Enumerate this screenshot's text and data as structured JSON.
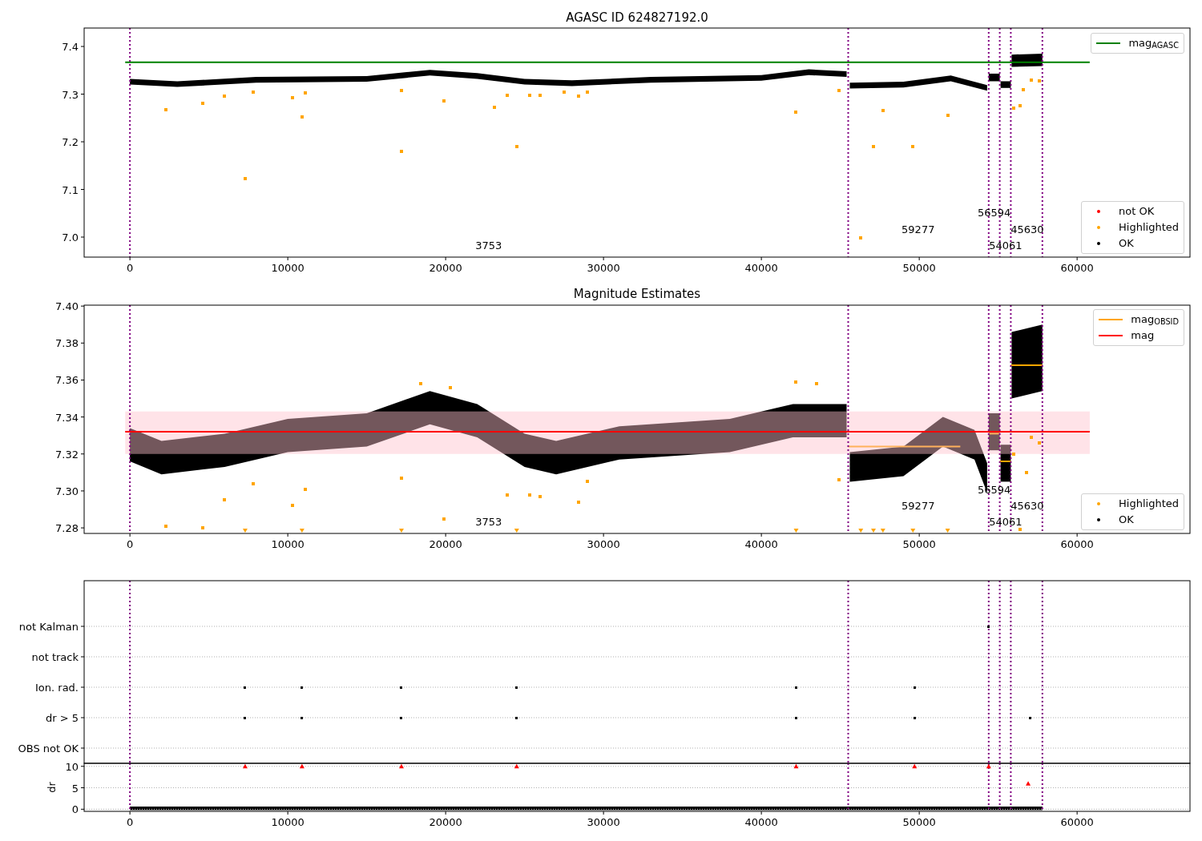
{
  "panels": [
    {
      "legends": [
        {
          "entries": [
            {
              "label": "mag$_{AGASC}$",
              "color": "#008000",
              "kind": "line"
            }
          ]
        },
        {
          "entries": [
            {
              "label": "not OK",
              "color": "#ff0000",
              "kind": "dot"
            },
            {
              "kind": "series"
            },
            {
              "label": "OK",
              "color": "#000000",
              "kind": "dot"
            }
          ]
        }
      ],
      "chart_data": {
        "type": "scatter",
        "title": "AGASC ID 624827192.0",
        "xlim": [
          -2900,
          67150
        ],
        "ylim": [
          6.958,
          7.4387
        ],
        "xticks": [
          0,
          10000,
          20000,
          30000,
          40000,
          50000,
          60000
        ],
        "yticks": [
          {
            "value": 7.0,
            "label": "7.0"
          },
          {
            "value": 7.1,
            "label": "7.1"
          },
          {
            "value": 7.2,
            "label": "7.2"
          },
          {
            "value": 7.3,
            "label": "7.3"
          },
          {
            "value": 7.4,
            "label": "7.4"
          }
        ],
        "x": [
          2300,
          4600,
          6000,
          7300,
          7800,
          10300,
          10900,
          11100,
          17200,
          17200,
          19900,
          23100,
          23900,
          24500,
          25300,
          26000,
          27500,
          28400,
          29000,
          42200,
          44900,
          46300,
          47100,
          47700,
          49600,
          51800,
          56000,
          56400,
          56600,
          57100,
          57600
        ],
        "series": [
          {
            "name": "Highlighted",
            "color": "#ffa500",
            "values": [
              7.268,
              7.28,
              7.295,
              7.122,
              7.305,
              7.292,
              7.252,
              7.302,
              7.307,
              7.18,
              7.285,
              7.273,
              7.298,
              7.19,
              7.298,
              7.298,
              7.305,
              7.295,
              7.305,
              7.262,
              7.308,
              6.998,
              7.19,
              7.265,
              7.19,
              7.256,
              7.27,
              7.276,
              7.31,
              7.33,
              7.328
            ]
          }
        ],
        "ref_lines": [
          {
            "axis": "y",
            "value": 7.367,
            "color": "#008000"
          },
          {
            "axis": "x",
            "value": 0,
            "color": "#800080"
          },
          {
            "axis": "x",
            "value": 45500,
            "color": "#800080"
          },
          {
            "axis": "x",
            "value": 54400,
            "color": "#800080"
          },
          {
            "axis": "x",
            "value": 55100,
            "color": "#800080"
          },
          {
            "axis": "x",
            "value": 55800,
            "color": "#800080"
          },
          {
            "axis": "x",
            "value": 57800,
            "color": "#800080"
          }
        ],
        "annotations": [
          "3753",
          "59277",
          "56594",
          "45630",
          "54061"
        ]
      }
    },
    {
      "legends": [
        {
          "entries": [
            {
              "label": "mag$_{OBSID}$",
              "color": "#ffa500",
              "kind": "line"
            },
            {
              "label": "mag",
              "color": "#ff0000",
              "kind": "line"
            }
          ]
        },
        {
          "entries": [
            {
              "kind": "series"
            },
            {
              "label": "OK",
              "color": "#000000",
              "kind": "dot"
            }
          ]
        }
      ],
      "chart_data": {
        "type": "scatter",
        "title": "Magnitude Estimates",
        "xlim": [
          -2900,
          67150
        ],
        "ylim": [
          7.277,
          7.4005
        ],
        "xticks": [
          0,
          10000,
          20000,
          30000,
          40000,
          50000,
          60000
        ],
        "yticks": [
          {
            "value": 7.28,
            "label": "7.28"
          },
          {
            "value": 7.3,
            "label": "7.30"
          },
          {
            "value": 7.32,
            "label": "7.32"
          },
          {
            "value": 7.34,
            "label": "7.34"
          },
          {
            "value": 7.36,
            "label": "7.36"
          },
          {
            "value": 7.38,
            "label": "7.38"
          },
          {
            "value": 7.4,
            "label": "7.40"
          }
        ],
        "x": [
          2300,
          4600,
          6000,
          7800,
          10300,
          11100,
          17200,
          18400,
          19900,
          20300,
          23900,
          25300,
          26000,
          28400,
          29000,
          42200,
          43500,
          44900,
          56000,
          56400,
          56800,
          57100,
          57600
        ],
        "series": [
          {
            "name": "Highlighted",
            "color": "#ffa500",
            "values": [
              7.281,
              7.28,
              7.295,
              7.304,
              7.292,
              7.301,
              7.307,
              7.358,
              7.285,
              7.356,
              7.298,
              7.298,
              7.297,
              7.294,
              7.305,
              7.359,
              7.358,
              7.306,
              7.32,
              7.279,
              7.31,
              7.329,
              7.326
            ]
          }
        ],
        "bands": [
          {
            "axis": "y",
            "from": 7.32,
            "to": 7.343,
            "color": "#ffc0cb"
          }
        ],
        "ref_lines": [
          {
            "axis": "y",
            "value": 7.332,
            "color": "#ff0000"
          },
          {
            "axis": "x",
            "value": 0,
            "color": "#800080"
          },
          {
            "axis": "x",
            "value": 45500,
            "color": "#800080"
          },
          {
            "axis": "x",
            "value": 54400,
            "color": "#800080"
          },
          {
            "axis": "x",
            "value": 55100,
            "color": "#800080"
          },
          {
            "axis": "x",
            "value": 55800,
            "color": "#800080"
          },
          {
            "axis": "x",
            "value": 57800,
            "color": "#800080"
          }
        ],
        "annotations": [
          "3753",
          "59277",
          "56594",
          "45630",
          "54061"
        ]
      }
    },
    {
      "flags": {
        "row_labels": [
          "not Kalman",
          "not track",
          "Ion. rad.",
          "dr > 5",
          "OBS not OK"
        ]
      },
      "dr": {
        "chart_data": {
          "type": "scatter",
          "ylabel": "dr",
          "xlim": [
            -2900,
            67150
          ],
          "ylim": [
            -0.5,
            10.7
          ],
          "grid": true,
          "xticks": [
            0,
            10000,
            20000,
            30000,
            40000,
            50000,
            60000
          ],
          "yticks": [
            0,
            5,
            10
          ],
          "x": [
            7300,
            10900,
            17200,
            24500,
            42200,
            49700,
            54400,
            56900
          ],
          "series": [
            {
              "color": "#ff0000",
              "values": [
                10,
                10,
                10,
                10,
                10,
                10,
                10,
                6
              ]
            }
          ],
          "ref_lines": [
            {
              "axis": "x",
              "value": 0,
              "color": "#800080"
            },
            {
              "axis": "x",
              "value": 45500,
              "color": "#800080"
            },
            {
              "axis": "x",
              "value": 54400,
              "color": "#800080"
            },
            {
              "axis": "x",
              "value": 55100,
              "color": "#800080"
            },
            {
              "axis": "x",
              "value": 55800,
              "color": "#800080"
            },
            {
              "axis": "x",
              "value": 57800,
              "color": "#800080"
            }
          ]
        }
      }
    }
  ]
}
